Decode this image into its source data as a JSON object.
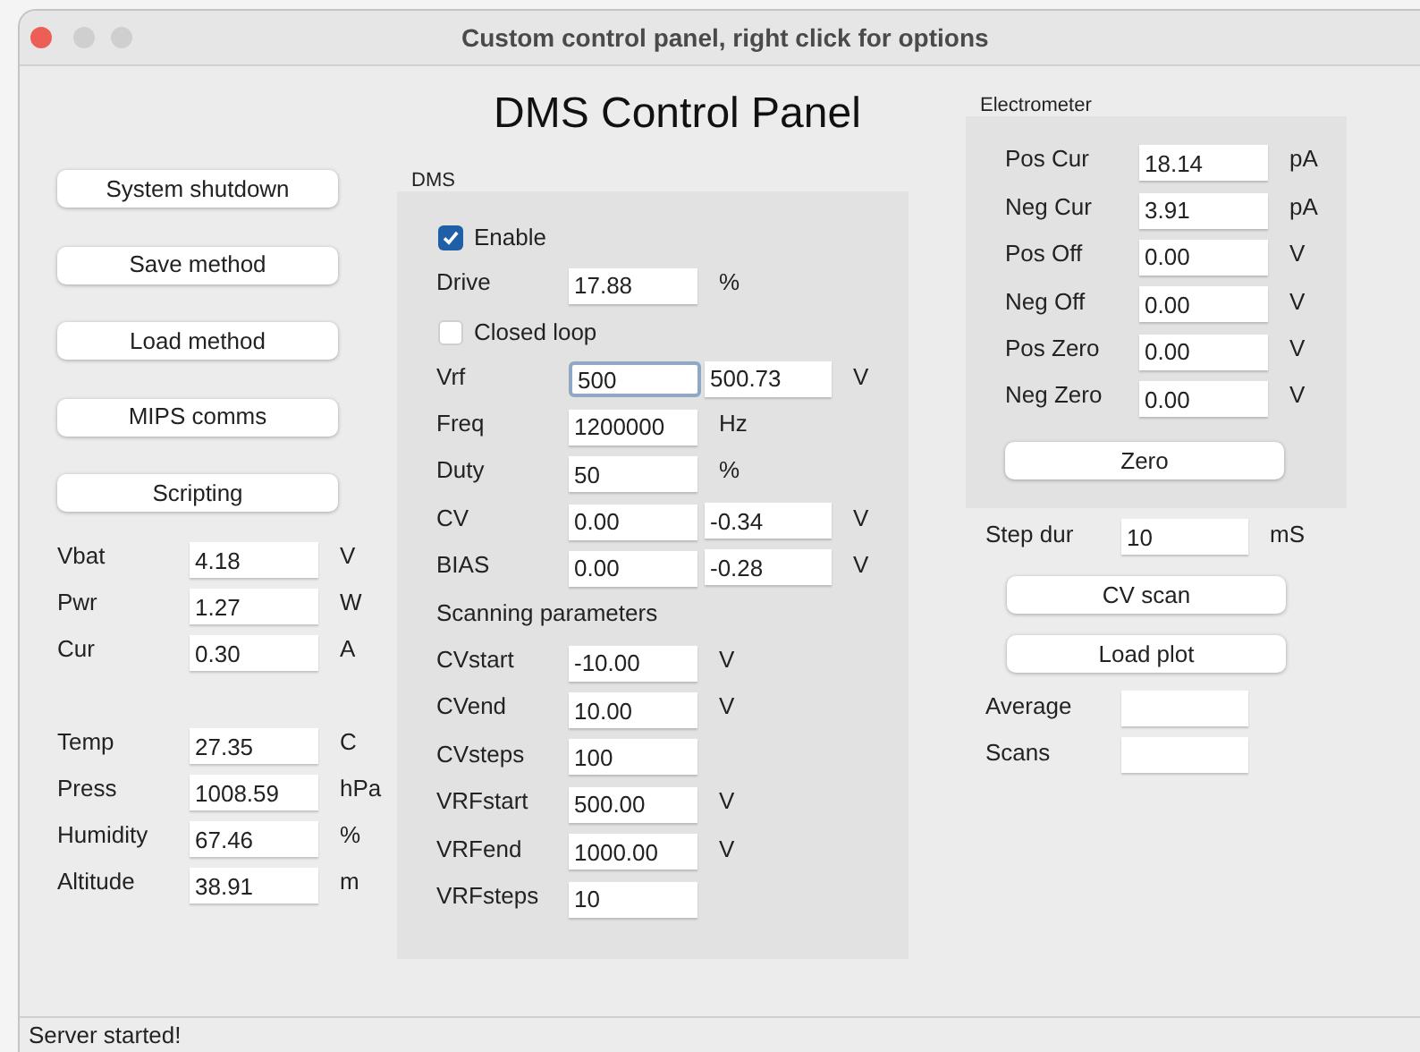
{
  "window": {
    "title": "Custom control panel, right click for options"
  },
  "heading": "DMS Control Panel",
  "buttons": [
    "System shutdown",
    "Save method",
    "Load method",
    "MIPS comms",
    "Scripting"
  ],
  "power_readings": [
    {
      "label": "Vbat",
      "value": "4.18",
      "unit": "V"
    },
    {
      "label": "Pwr",
      "value": "1.27",
      "unit": "W"
    },
    {
      "label": "Cur",
      "value": "0.30",
      "unit": "A"
    }
  ],
  "environment_readings": [
    {
      "label": "Temp",
      "value": "27.35",
      "unit": "C"
    },
    {
      "label": "Press",
      "value": "1008.59",
      "unit": "hPa"
    },
    {
      "label": "Humidity",
      "value": "67.46",
      "unit": "%"
    },
    {
      "label": "Altitude",
      "value": "38.91",
      "unit": "m"
    }
  ],
  "dms": {
    "title": "DMS",
    "items": [
      {
        "kind": "checkbox",
        "label": "Enable",
        "checked": true
      },
      {
        "kind": "field",
        "label": "Drive",
        "value": "17.88",
        "unit": "%"
      },
      {
        "kind": "checkbox",
        "label": "Closed loop",
        "checked": false
      },
      {
        "kind": "dual",
        "label": "Vrf",
        "value": "500",
        "value2": "500.73",
        "unit": "V",
        "focused": true
      },
      {
        "kind": "field",
        "label": "Freq",
        "value": "1200000",
        "unit": "Hz"
      },
      {
        "kind": "field",
        "label": "Duty",
        "value": "50",
        "unit": "%"
      },
      {
        "kind": "dual",
        "label": "CV",
        "value": "0.00",
        "value2": "-0.34",
        "unit": "V"
      },
      {
        "kind": "dual",
        "label": "BIAS",
        "value": "0.00",
        "value2": "-0.28",
        "unit": "V"
      },
      {
        "kind": "heading",
        "label": "Scanning parameters"
      },
      {
        "kind": "field",
        "label": "CVstart",
        "value": "-10.00",
        "unit": "V"
      },
      {
        "kind": "field",
        "label": "CVend",
        "value": "10.00",
        "unit": "V"
      },
      {
        "kind": "field",
        "label": "CVsteps",
        "value": "100"
      },
      {
        "kind": "field",
        "label": "VRFstart",
        "value": "500.00",
        "unit": "V"
      },
      {
        "kind": "field",
        "label": "VRFend",
        "value": "1000.00",
        "unit": "V"
      },
      {
        "kind": "field",
        "label": "VRFsteps",
        "value": "10"
      }
    ]
  },
  "electrometer": {
    "title": "Electrometer",
    "rows": [
      {
        "label": "Pos Cur",
        "value": "18.14",
        "unit": "pA"
      },
      {
        "label": "Neg Cur",
        "value": "3.91",
        "unit": "pA"
      },
      {
        "label": "Pos Off",
        "value": "0.00",
        "unit": "V"
      },
      {
        "label": "Neg Off",
        "value": "0.00",
        "unit": "V"
      },
      {
        "label": "Pos Zero",
        "value": "0.00",
        "unit": "V"
      },
      {
        "label": "Neg Zero",
        "value": "0.00",
        "unit": "V"
      }
    ],
    "button": "Zero"
  },
  "step_dur": {
    "label": "Step dur",
    "value": "10",
    "unit": "mS"
  },
  "scan_buttons": [
    "CV scan",
    "Load plot"
  ],
  "stats": [
    {
      "label": "Average"
    },
    {
      "label": "Scans"
    }
  ],
  "status_bar": "Server started!"
}
